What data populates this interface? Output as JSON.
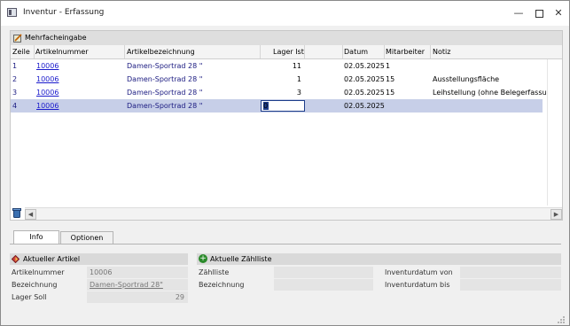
{
  "window": {
    "title": "Inventur - Erfassung",
    "min": "—",
    "close": "✕"
  },
  "grid": {
    "group_label": "Mehrfacheingabe",
    "columns": [
      "Zeile",
      "Artikelnummer",
      "Artikelbezeichnung",
      "Lager Ist",
      "Datum",
      "Mitarbeiter",
      "Notiz"
    ],
    "rows": [
      {
        "zeile": "1",
        "artikelnummer": "10006",
        "bezeichnung": "Damen-Sportrad 28 \"",
        "lager_ist": "11",
        "datum": "02.05.2025",
        "mitarbeiter": "1",
        "notiz": ""
      },
      {
        "zeile": "2",
        "artikelnummer": "10006",
        "bezeichnung": "Damen-Sportrad 28 \"",
        "lager_ist": "1",
        "datum": "02.05.2025",
        "mitarbeiter": "15",
        "notiz": "Ausstellungsfläche"
      },
      {
        "zeile": "3",
        "artikelnummer": "10006",
        "bezeichnung": "Damen-Sportrad 28 \"",
        "lager_ist": "3",
        "datum": "02.05.2025",
        "mitarbeiter": "15",
        "notiz": "Leihstellung (ohne Belegerfassung)"
      },
      {
        "zeile": "4",
        "artikelnummer": "10006",
        "bezeichnung": "Damen-Sportrad 28 \"",
        "lager_ist": "0",
        "datum": "02.05.2025",
        "mitarbeiter": "",
        "notiz": ""
      }
    ],
    "scroll_left": "◀",
    "scroll_right": "▶"
  },
  "tabs": [
    "Info",
    "Optionen"
  ],
  "current_article": {
    "title": "Aktueller Artikel",
    "fields": [
      {
        "label": "Artikelnummer",
        "value": "10006"
      },
      {
        "label": "Bezeichnung",
        "value": "Damen-Sportrad 28\""
      },
      {
        "label": "Lager Soll",
        "value": "29"
      }
    ]
  },
  "count_list": {
    "title": "Aktuelle Zählliste",
    "fields": [
      {
        "label": "Zählliste",
        "value": ""
      },
      {
        "label": "Bezeichnung",
        "value": ""
      }
    ],
    "fields_right": [
      {
        "label": "Inventurdatum von",
        "value": ""
      },
      {
        "label": "Inventurdatum bis",
        "value": ""
      }
    ]
  },
  "colors": {
    "selected_row": "#c7cfe8",
    "link": "#1a1acc"
  }
}
